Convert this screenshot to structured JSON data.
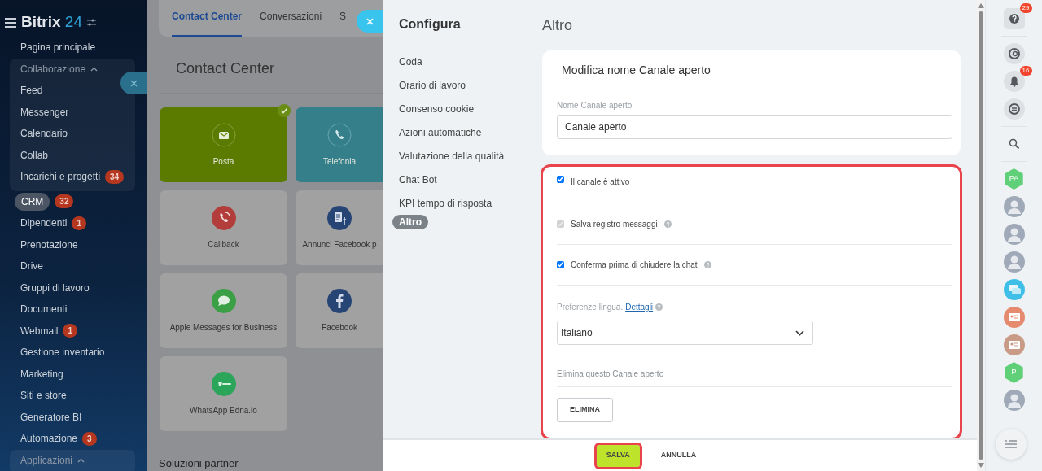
{
  "sidebar": {
    "logo": {
      "name": "Bitrix",
      "number": "24"
    },
    "items": [
      {
        "kind": "link",
        "label": "Pagina principale",
        "selected": false
      },
      {
        "kind": "group",
        "label": "Collaborazione",
        "expanded": true,
        "selected": false,
        "children": [
          {
            "kind": "link",
            "label": "Feed",
            "selected": false
          },
          {
            "kind": "link",
            "label": "Messenger",
            "selected": false
          },
          {
            "kind": "link",
            "label": "Calendario",
            "selected": false
          },
          {
            "kind": "link",
            "label": "Collab",
            "selected": false
          },
          {
            "kind": "link",
            "label": "Incarichi e progetti",
            "badge": "34",
            "selected": false
          }
        ]
      },
      {
        "kind": "link",
        "label": "CRM",
        "badge": "32",
        "selected": true
      },
      {
        "kind": "link",
        "label": "Dipendenti",
        "badge": "1",
        "selected": false
      },
      {
        "kind": "link",
        "label": "Prenotazione",
        "selected": false
      },
      {
        "kind": "link",
        "label": "Drive",
        "selected": false
      },
      {
        "kind": "link",
        "label": "Gruppi di lavoro",
        "selected": false
      },
      {
        "kind": "link",
        "label": "Documenti",
        "selected": false
      },
      {
        "kind": "link",
        "label": "Webmail",
        "badge": "1",
        "selected": false
      },
      {
        "kind": "link",
        "label": "Gestione inventario",
        "selected": false
      },
      {
        "kind": "link",
        "label": "Marketing",
        "selected": false
      },
      {
        "kind": "link",
        "label": "Siti e store",
        "selected": false
      },
      {
        "kind": "link",
        "label": "Generatore BI",
        "selected": false
      },
      {
        "kind": "link",
        "label": "Automazione",
        "badge": "3",
        "selected": false
      },
      {
        "kind": "group",
        "label": "Applicazioni",
        "expanded": true,
        "selected": false
      }
    ]
  },
  "background_page": {
    "tabs": [
      {
        "label": "Contact Center",
        "selected": true
      },
      {
        "label": "Conversazioni",
        "selected": false
      },
      {
        "label": "S",
        "selected": false
      }
    ],
    "title": "Contact Center",
    "tiles": [
      {
        "kind": "mail",
        "label": "Posta",
        "color": "#5a7a00",
        "connected": true
      },
      {
        "kind": "phone",
        "label": "Telefonia",
        "color": "#357f8a",
        "connected": false
      },
      {
        "kind": "callback",
        "label": "Callback",
        "connected": false
      },
      {
        "kind": "fb-ads",
        "label": "Annunci Facebook p",
        "connected": false
      },
      {
        "kind": "chat",
        "label": "Apple Messages for Business",
        "connected": false
      },
      {
        "kind": "facebook",
        "label": "Facebook",
        "connected": false
      },
      {
        "kind": "edna",
        "label": "WhatsApp Edna.io",
        "connected": false
      }
    ],
    "section": "Soluzioni partner"
  },
  "slider": {
    "menu": {
      "title": "Configura",
      "items": [
        {
          "label": "Coda",
          "selected": false
        },
        {
          "label": "Orario di lavoro",
          "selected": false
        },
        {
          "label": "Consenso cookie",
          "selected": false
        },
        {
          "label": "Azioni automatiche",
          "selected": false
        },
        {
          "label": "Valutazione della qualità",
          "selected": false
        },
        {
          "label": "Chat Bot",
          "selected": false
        },
        {
          "label": "KPI tempo di risposta",
          "selected": false
        },
        {
          "label": "Altro",
          "selected": true
        }
      ]
    },
    "title": "Altro",
    "name_card": {
      "title": "Modifica nome Canale aperto",
      "field_label": "Nome Canale aperto",
      "value": "Canale aperto"
    },
    "settings_card": {
      "highlighted": true,
      "options": [
        {
          "label": "Il canale è attivo",
          "checked": true,
          "disabled": false
        },
        {
          "label": "Salva registro messaggi",
          "checked": true,
          "disabled": true,
          "help": true
        },
        {
          "label": "Conferma prima di chiudere la chat",
          "checked": true,
          "disabled": false,
          "help": true
        }
      ],
      "language": {
        "label": "Preferenze lingua.",
        "link": "Dettagli",
        "value": "Italiano"
      },
      "delete": {
        "label": "Elimina questo Canale aperto",
        "button": "ELIMINA"
      }
    },
    "footer": [
      {
        "kind": "primary",
        "label": "SALVA",
        "highlighted": true
      },
      {
        "kind": "link",
        "label": "ANNULLA",
        "highlighted": false
      }
    ]
  },
  "right_bar": {
    "help_badge": "29",
    "notifications_badge": "16",
    "contacts": [
      {
        "kind": "hex",
        "text": "PA"
      },
      {
        "kind": "photo"
      },
      {
        "kind": "photo"
      },
      {
        "kind": "photo"
      },
      {
        "kind": "chat"
      },
      {
        "kind": "card",
        "color": "#e58a6e"
      },
      {
        "kind": "card",
        "color": "#c99a86"
      },
      {
        "kind": "hex",
        "text": "P"
      },
      {
        "kind": "photo"
      }
    ]
  }
}
